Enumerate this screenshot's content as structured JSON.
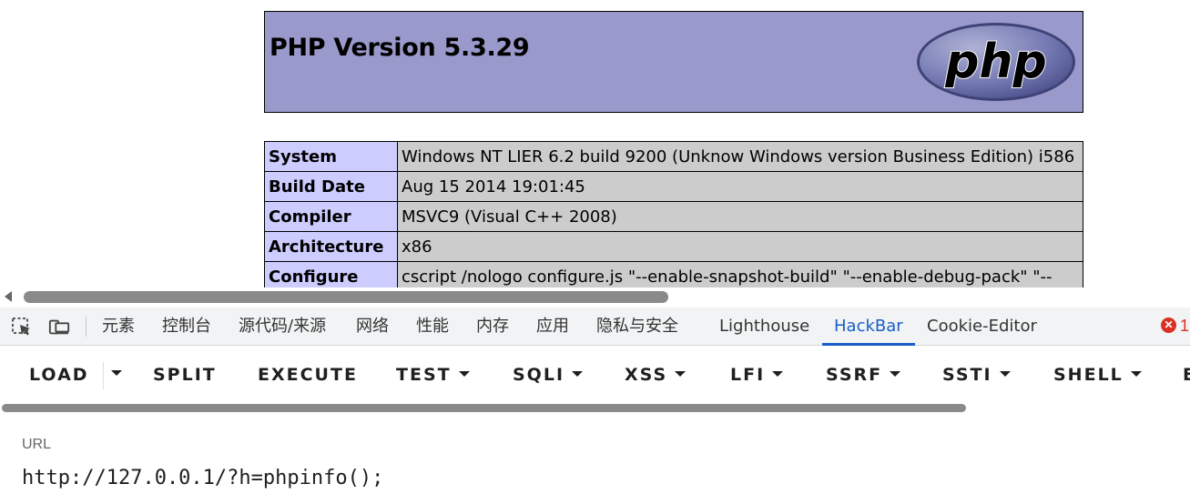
{
  "phpinfo": {
    "title": "PHP Version 5.3.29",
    "logo_text": "php",
    "rows": [
      {
        "label": "System",
        "value": "Windows NT LIER 6.2 build 9200 (Unknow Windows version Business Edition) i586"
      },
      {
        "label": "Build Date",
        "value": "Aug 15 2014 19:01:45"
      },
      {
        "label": "Compiler",
        "value": "MSVC9 (Visual C++ 2008)"
      },
      {
        "label": "Architecture",
        "value": "x86"
      },
      {
        "label": "Configure",
        "value": "cscript /nologo configure.js \"--enable-snapshot-build\" \"--enable-debug-pack\" \"--"
      }
    ]
  },
  "devtools": {
    "tabs": [
      {
        "label": "元素"
      },
      {
        "label": "控制台"
      },
      {
        "label": "源代码/来源"
      },
      {
        "label": "网络"
      },
      {
        "label": "性能"
      },
      {
        "label": "内存"
      },
      {
        "label": "应用"
      },
      {
        "label": "隐私与安全"
      },
      {
        "label": "Lighthouse"
      },
      {
        "label": "HackBar"
      },
      {
        "label": "Cookie-Editor"
      }
    ],
    "active_tab": "HackBar",
    "error_count": "1",
    "icons": [
      "inspect-element-icon",
      "device-toolbar-icon",
      "error-icon"
    ]
  },
  "hackbar": {
    "buttons": [
      {
        "label": "LOAD"
      },
      {
        "label": "SPLIT"
      },
      {
        "label": "EXECUTE"
      },
      {
        "label": "TEST"
      },
      {
        "label": "SQLI"
      },
      {
        "label": "XSS"
      },
      {
        "label": "LFI"
      },
      {
        "label": "SSRF"
      },
      {
        "label": "SSTI"
      },
      {
        "label": "SHELL"
      },
      {
        "label": "E"
      }
    ],
    "url_label": "URL",
    "url_value": "http://127.0.0.1/?h=phpinfo();"
  },
  "colors": {
    "php_header_bg": "#9999cc",
    "php_label_bg": "#ccccff",
    "php_value_bg": "#cccccc",
    "active_tab": "#1a5dc9",
    "error": "#d93025"
  }
}
